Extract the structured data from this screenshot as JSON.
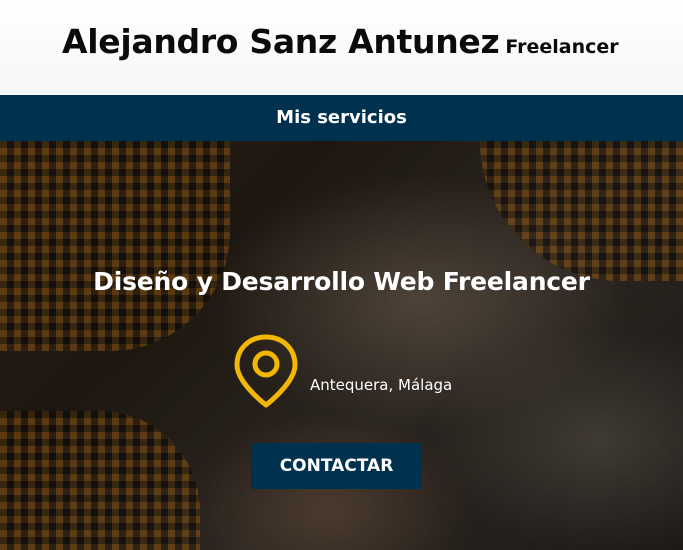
{
  "header": {
    "name": "Alejandro Sanz Antunez",
    "role": "Freelancer"
  },
  "nav": {
    "services_label": "Mis servicios"
  },
  "hero": {
    "title": "Diseño y Desarrollo Web Freelancer",
    "location_icon": "map-pin-icon",
    "location": "Antequera, Málaga",
    "cta_label": "CONTACTAR"
  },
  "colors": {
    "navy": "#00314f",
    "pin_yellow": "#f2b705",
    "text_dark": "#0b0b0b"
  }
}
